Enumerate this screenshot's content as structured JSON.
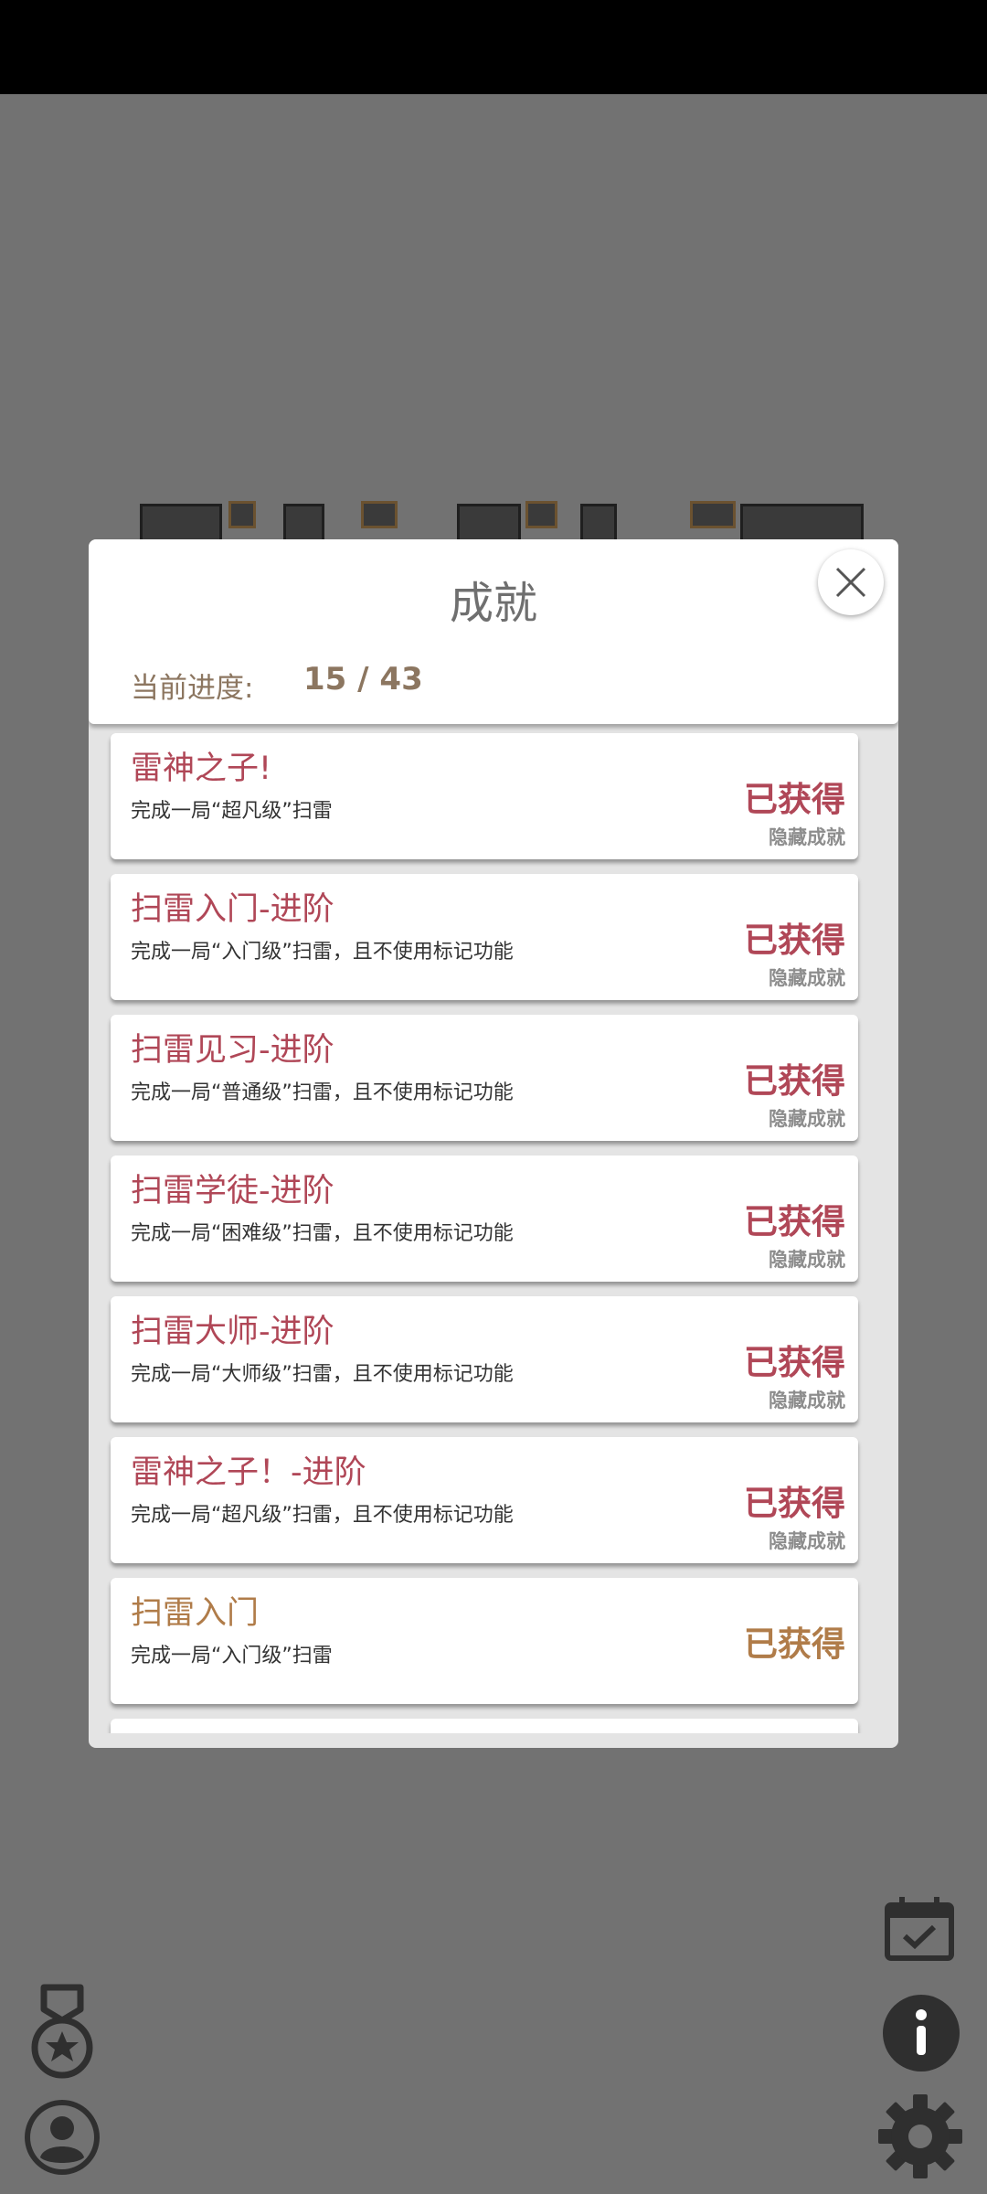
{
  "modal": {
    "title": "成就",
    "progress_label": "当前进度:",
    "progress_value": "15 / 43"
  },
  "achievements": [
    {
      "title": "雷神之子!",
      "desc": "完成一局“超凡级”扫雷",
      "status": "已获得",
      "tag": "隐藏成就"
    },
    {
      "title": "扫雷入门-进阶",
      "desc": "完成一局“入门级”扫雷，且不使用标记功能",
      "status": "已获得",
      "tag": "隐藏成就"
    },
    {
      "title": "扫雷见习-进阶",
      "desc": "完成一局“普通级”扫雷，且不使用标记功能",
      "status": "已获得",
      "tag": "隐藏成就"
    },
    {
      "title": "扫雷学徒-进阶",
      "desc": "完成一局“困难级”扫雷，且不使用标记功能",
      "status": "已获得",
      "tag": "隐藏成就"
    },
    {
      "title": "扫雷大师-进阶",
      "desc": "完成一局“大师级”扫雷，且不使用标记功能",
      "status": "已获得",
      "tag": "隐藏成就"
    },
    {
      "title": "雷神之子！-进阶",
      "desc": "完成一局“超凡级”扫雷，且不使用标记功能",
      "status": "已获得",
      "tag": "隐藏成就"
    },
    {
      "title": "扫雷入门",
      "desc": "完成一局“入门级”扫雷",
      "status": "已获得",
      "tag": ""
    }
  ],
  "colors": {
    "hidden_accent": "#b04757",
    "normal_accent": "#b07c49",
    "backdrop": "#727272"
  },
  "icons": [
    "close-icon",
    "medal-icon",
    "profile-icon",
    "calendar-check-icon",
    "info-icon",
    "gear-icon"
  ]
}
